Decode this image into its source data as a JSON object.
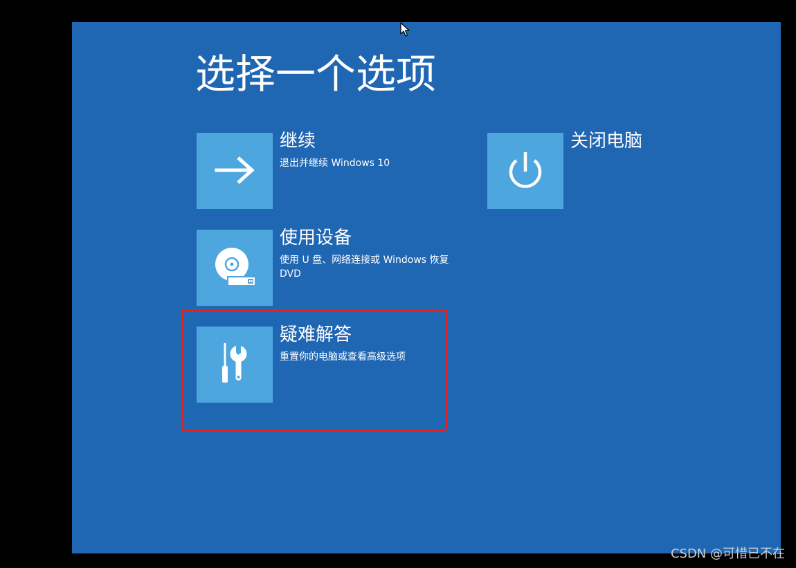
{
  "page_title": "选择一个选项",
  "options": [
    {
      "label": "继续",
      "description": "退出并继续 Windows 10",
      "icon": "arrow-right-icon"
    },
    {
      "label": "使用设备",
      "description": "使用 U 盘、网络连接或 Windows 恢复 DVD",
      "icon": "disc-usb-icon"
    },
    {
      "label": "疑难解答",
      "description": "重置你的电脑或查看高级选项",
      "icon": "screwdriver-wrench-icon"
    },
    {
      "label": "关闭电脑",
      "description": "",
      "icon": "power-icon"
    }
  ],
  "watermark": "CSDN @可惜已不在",
  "colors": {
    "background": "#1f66b3",
    "tile": "#4ea6df",
    "highlight": "#e0231f",
    "frame": "#000000"
  }
}
